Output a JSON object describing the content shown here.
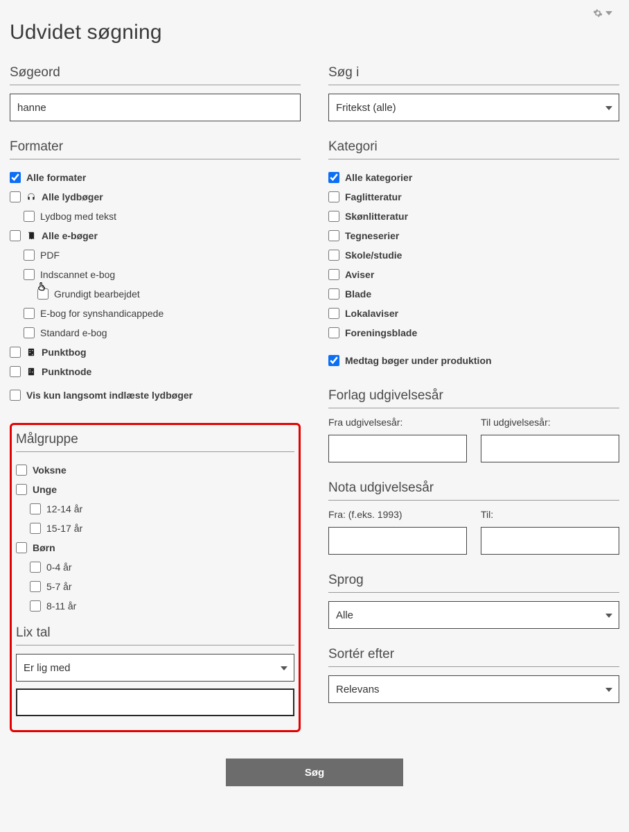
{
  "page_title": "Udvidet søgning",
  "search_term": {
    "label": "Søgeord",
    "value": "hanne"
  },
  "search_in": {
    "label": "Søg i",
    "selected": "Fritekst (alle)"
  },
  "formats": {
    "label": "Formater",
    "all": "Alle formater",
    "audiobooks": "Alle lydbøger",
    "audiobook_text": "Lydbog med tekst",
    "ebooks": "Alle e-bøger",
    "pdf": "PDF",
    "scanned": "Indscannet e-bog",
    "thorough": "Grundigt bearbejdet",
    "visually": "E-bog for synshandicappede",
    "standard": "Standard e-bog",
    "punktbog": "Punktbog",
    "punktnode": "Punktnode",
    "slow_only": "Vis kun langsomt indlæste lydbøger"
  },
  "categories": {
    "label": "Kategori",
    "all": "Alle kategorier",
    "nonfiction": "Faglitteratur",
    "fiction": "Skønlitteratur",
    "comics": "Tegneserier",
    "school": "Skole/studie",
    "newspapers": "Aviser",
    "magazines": "Blade",
    "local_news": "Lokalaviser",
    "club_mags": "Foreningsblade",
    "include_production": "Medtag bøger under produktion"
  },
  "target_group": {
    "label": "Målgruppe",
    "adults": "Voksne",
    "youth": "Unge",
    "age_12_14": "12-14 år",
    "age_15_17": "15-17 år",
    "children": "Børn",
    "age_0_4": "0-4 år",
    "age_5_7": "5-7 år",
    "age_8_11": "8-11 år"
  },
  "lix": {
    "label": "Lix tal",
    "operator": "Er lig med",
    "value": ""
  },
  "publisher_year": {
    "label": "Forlag udgivelsesår",
    "from_label": "Fra udgivelsesår:",
    "to_label": "Til udgivelsesår:"
  },
  "nota_year": {
    "label": "Nota udgivelsesår",
    "from_label": "Fra: (f.eks. 1993)",
    "to_label": "Til:"
  },
  "language": {
    "label": "Sprog",
    "selected": "Alle"
  },
  "sort": {
    "label": "Sortér efter",
    "selected": "Relevans"
  },
  "submit_label": "Søg"
}
